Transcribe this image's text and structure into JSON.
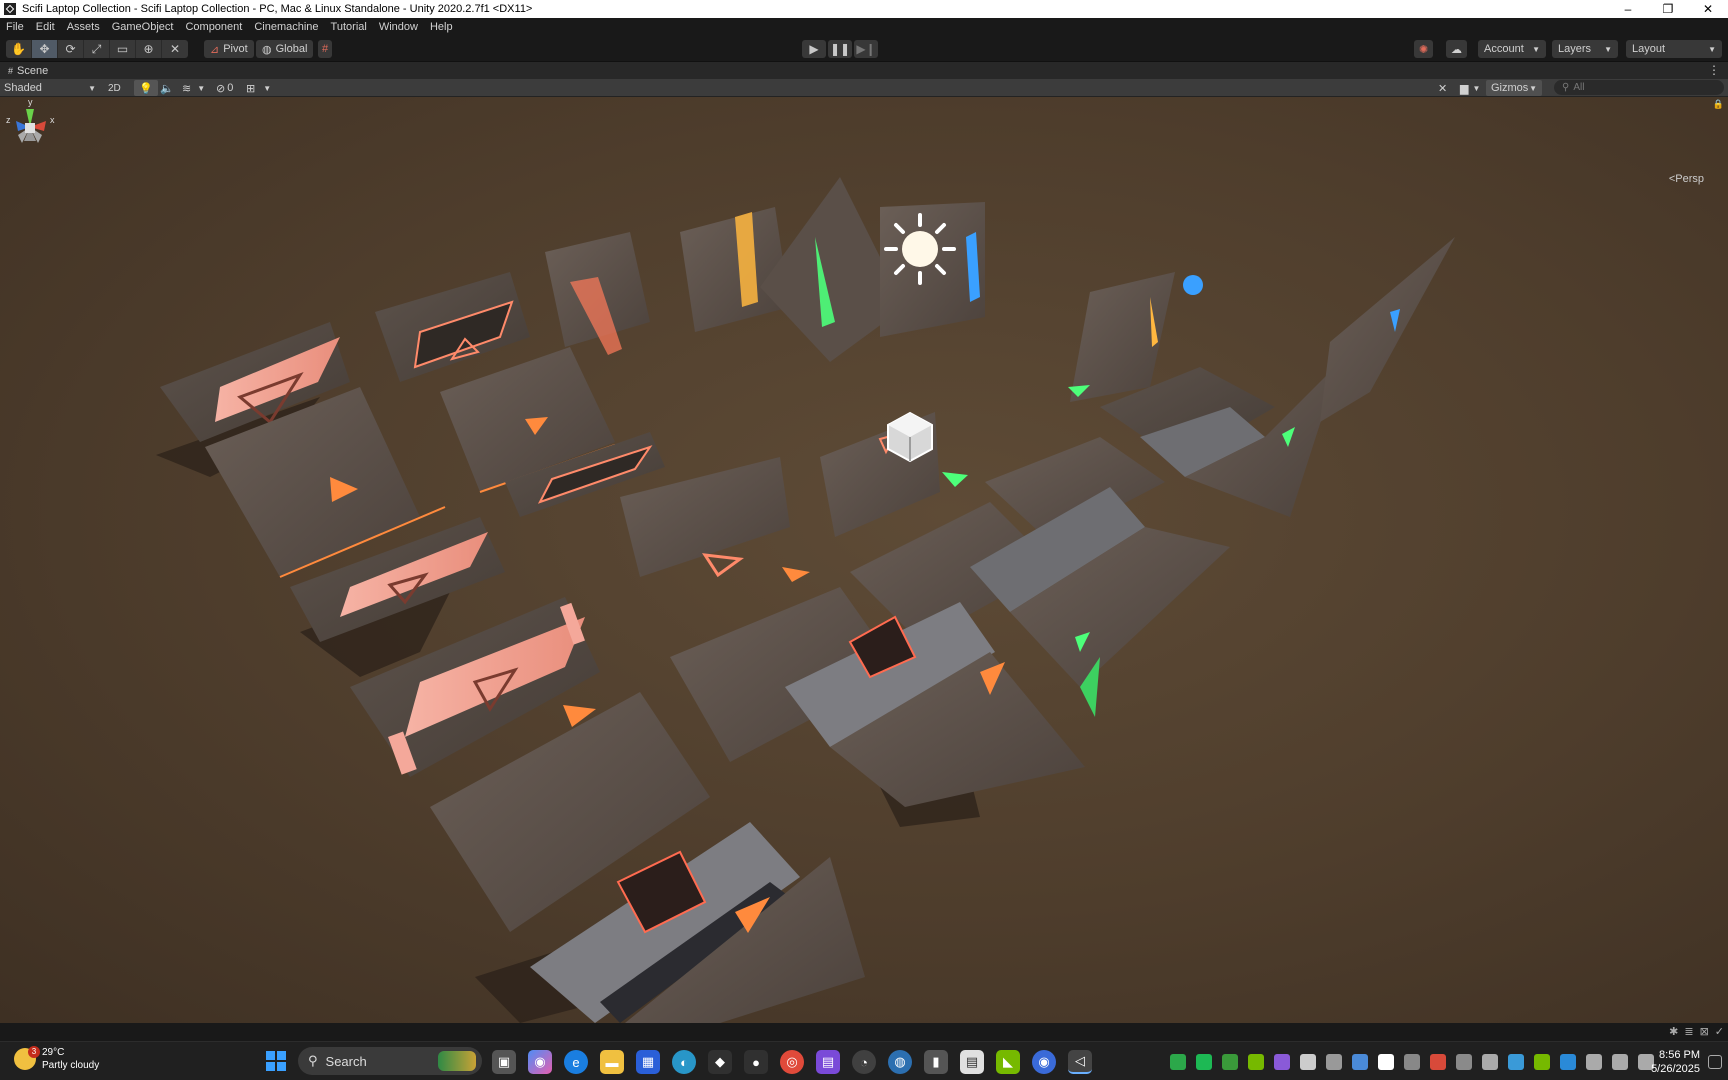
{
  "window": {
    "title": "Scifi Laptop Collection - Scifi Laptop Collection - PC, Mac & Linux Standalone - Unity 2020.2.7f1 <DX11>",
    "minimize": "–",
    "maximize": "❐",
    "close": "✕"
  },
  "menu": [
    "File",
    "Edit",
    "Assets",
    "GameObject",
    "Component",
    "Cinemachine",
    "Tutorial",
    "Window",
    "Help"
  ],
  "toolbar": {
    "pivot_label": "Pivot",
    "global_label": "Global",
    "account_label": "Account",
    "layers_label": "Layers",
    "layout_label": "Layout"
  },
  "scene": {
    "tab_label": "Scene",
    "shading_mode": "Shaded",
    "mode_2d": "2D",
    "hidden_count": "0",
    "gizmos_label": "Gizmos",
    "search_placeholder": "All",
    "projection_label": "<Persp",
    "axis_y": "y",
    "axis_x": "x",
    "axis_z": "z"
  },
  "taskbar": {
    "temperature": "29°C",
    "weather": "Partly cloudy",
    "weather_badge": "3",
    "search_label": "Search",
    "time": "8:56 PM",
    "date": "5/26/2025"
  },
  "colors": {
    "accent_orange": "#ff8a3d",
    "accent_green": "#4dff7a",
    "accent_blue": "#3aa0ff",
    "accent_yellow": "#ffb740",
    "screen_pink": "#f4a89a"
  }
}
